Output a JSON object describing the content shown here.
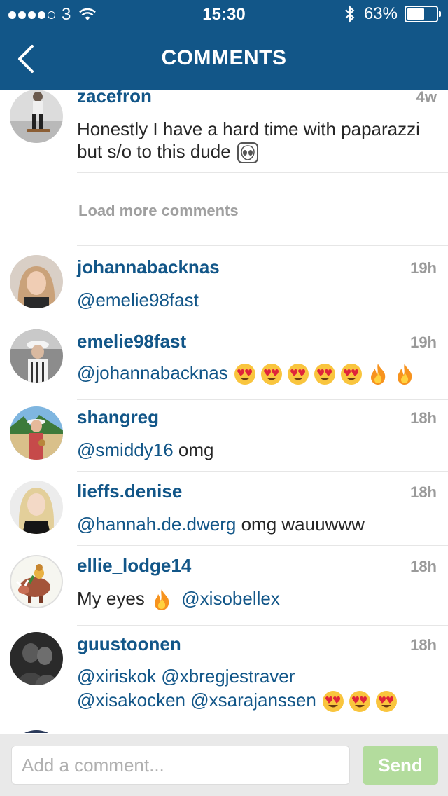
{
  "status_bar": {
    "carrier": "3",
    "time": "15:30",
    "battery": "63%",
    "battery_level": 0.63
  },
  "header": {
    "title": "COMMENTS"
  },
  "comments_top": {
    "username": "zacefron",
    "time": "4w",
    "text": "Honestly I have a hard time with paparazzi but s/o to this dude",
    "emoji": "alien-icon"
  },
  "load_more": "Load more comments",
  "comments": [
    {
      "username": "johannabacknas",
      "time": "19h",
      "mention": "@emelie98fast"
    },
    {
      "username": "emelie98fast",
      "time": "19h",
      "mention": "@johannabacknas"
    },
    {
      "username": "shangreg",
      "time": "18h",
      "mention": "@smiddy16",
      "text": "omg"
    },
    {
      "username": "lieffs.denise",
      "time": "18h",
      "mention": "@hannah.de.dwerg",
      "text": "omg wauuwww"
    },
    {
      "username": "ellie_lodge14",
      "time": "18h",
      "text": "My eyes",
      "mention": "@xisobellex"
    },
    {
      "username": "guustoonen_",
      "time": "18h",
      "mentions_line1": "@xiriskok @xbregjestraver",
      "mentions_line2": "@xisakocken @xsarajanssen"
    }
  ],
  "composer": {
    "placeholder": "Add a comment...",
    "send_label": "Send"
  },
  "colors": {
    "brand": "#125688",
    "send": "#b3dc9d",
    "muted": "#9a9a9a"
  }
}
